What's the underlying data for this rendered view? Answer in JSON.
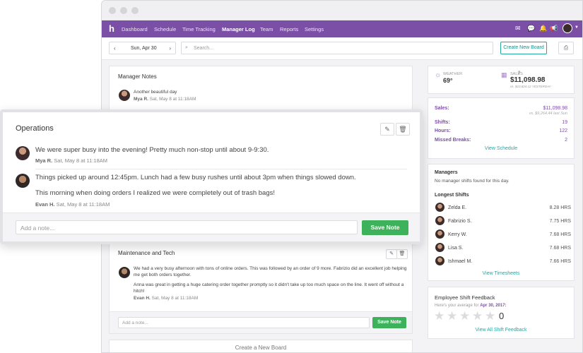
{
  "nav": {
    "logo": "h",
    "items": [
      {
        "label": "Dashboard"
      },
      {
        "label": "Schedule"
      },
      {
        "label": "Time Tracking"
      },
      {
        "label": "Manager Log"
      },
      {
        "label": "Team"
      },
      {
        "label": "Reports"
      },
      {
        "label": "Settings"
      }
    ],
    "active": "Manager Log",
    "accent": "#7b4fa6"
  },
  "toolbar": {
    "date": "Sun, Apr 30",
    "search_placeholder": "Search...",
    "create_label": "Create New Board"
  },
  "manager_notes": {
    "title": "Manager Notes",
    "note_text": "Another beautiful day",
    "author": "Mya R.",
    "time": "Sat, May 8 at 11:18AM"
  },
  "operations": {
    "title": "Operations",
    "notes": [
      {
        "text": "We were super busy into the evening! Pretty much non-stop until about 9-9:30.",
        "author": "Mya R.",
        "time": "Sat, May 8 at 11:18AM"
      },
      {
        "text": "Things picked up around 12:45pm. Lunch had a few busy rushes until about 3pm when things slowed down.",
        "text2": "This morning when doing orders I realized we were completely out of trash bags!",
        "author": "Evan H.",
        "time": "Sat, May 8 at 11:18AM"
      }
    ],
    "note_placeholder": "Add a note...",
    "save_label": "Save Note"
  },
  "maintenance": {
    "title": "Maintenance and Tech",
    "text1": "We had a very busy afternoon with tons of online orders. This was followed by an order of 9 more. Fabrizio did an excellent job helping me get both orders together.",
    "text2": "Anna was great in getting a huge catering order together promptly so it didn't take up too much space on the line. It went off without a hitch!",
    "author": "Evan H.",
    "time": "Sat, May 8 at 11:18AM",
    "note_placeholder": "Add a note...",
    "save_label": "Save Note"
  },
  "create_board_label": "Create a New Board",
  "weather": {
    "label": "WEATHER",
    "value": "69°"
  },
  "sales": {
    "label": "SALES",
    "value": "$11,098.98",
    "sub": "vs. $10,824.12 YESTERDAY"
  },
  "stats": {
    "rows": [
      {
        "label": "Sales:",
        "value": "$11,098.98",
        "sub": "vs. $9,264.44 last Sun"
      },
      {
        "label": "Shifts:",
        "value": "19"
      },
      {
        "label": "Hours:",
        "value": "122"
      },
      {
        "label": "Missed Breaks:",
        "value": "2"
      }
    ],
    "link": "View Schedule"
  },
  "managers": {
    "title": "Managers",
    "empty": "No manager shifts found for this day.",
    "longest_title": "Longest Shifts",
    "shifts": [
      {
        "name": "Zelda E.",
        "hours": "8.28 HRS"
      },
      {
        "name": "Fabrizio S.",
        "hours": "7.75 HRS"
      },
      {
        "name": "Kerry W.",
        "hours": "7.68 HRS"
      },
      {
        "name": "Lisa S.",
        "hours": "7.68 HRS"
      },
      {
        "name": "Ishmael M.",
        "hours": "7.66 HRS"
      }
    ],
    "link": "View Timesheets"
  },
  "feedback": {
    "title": "Employee Shift Feedback",
    "sub_prefix": "Here's your average for",
    "date": "Apr 30, 2017:",
    "score": "0",
    "rating": 0,
    "max": 5,
    "link": "View All Shift Feedback"
  }
}
